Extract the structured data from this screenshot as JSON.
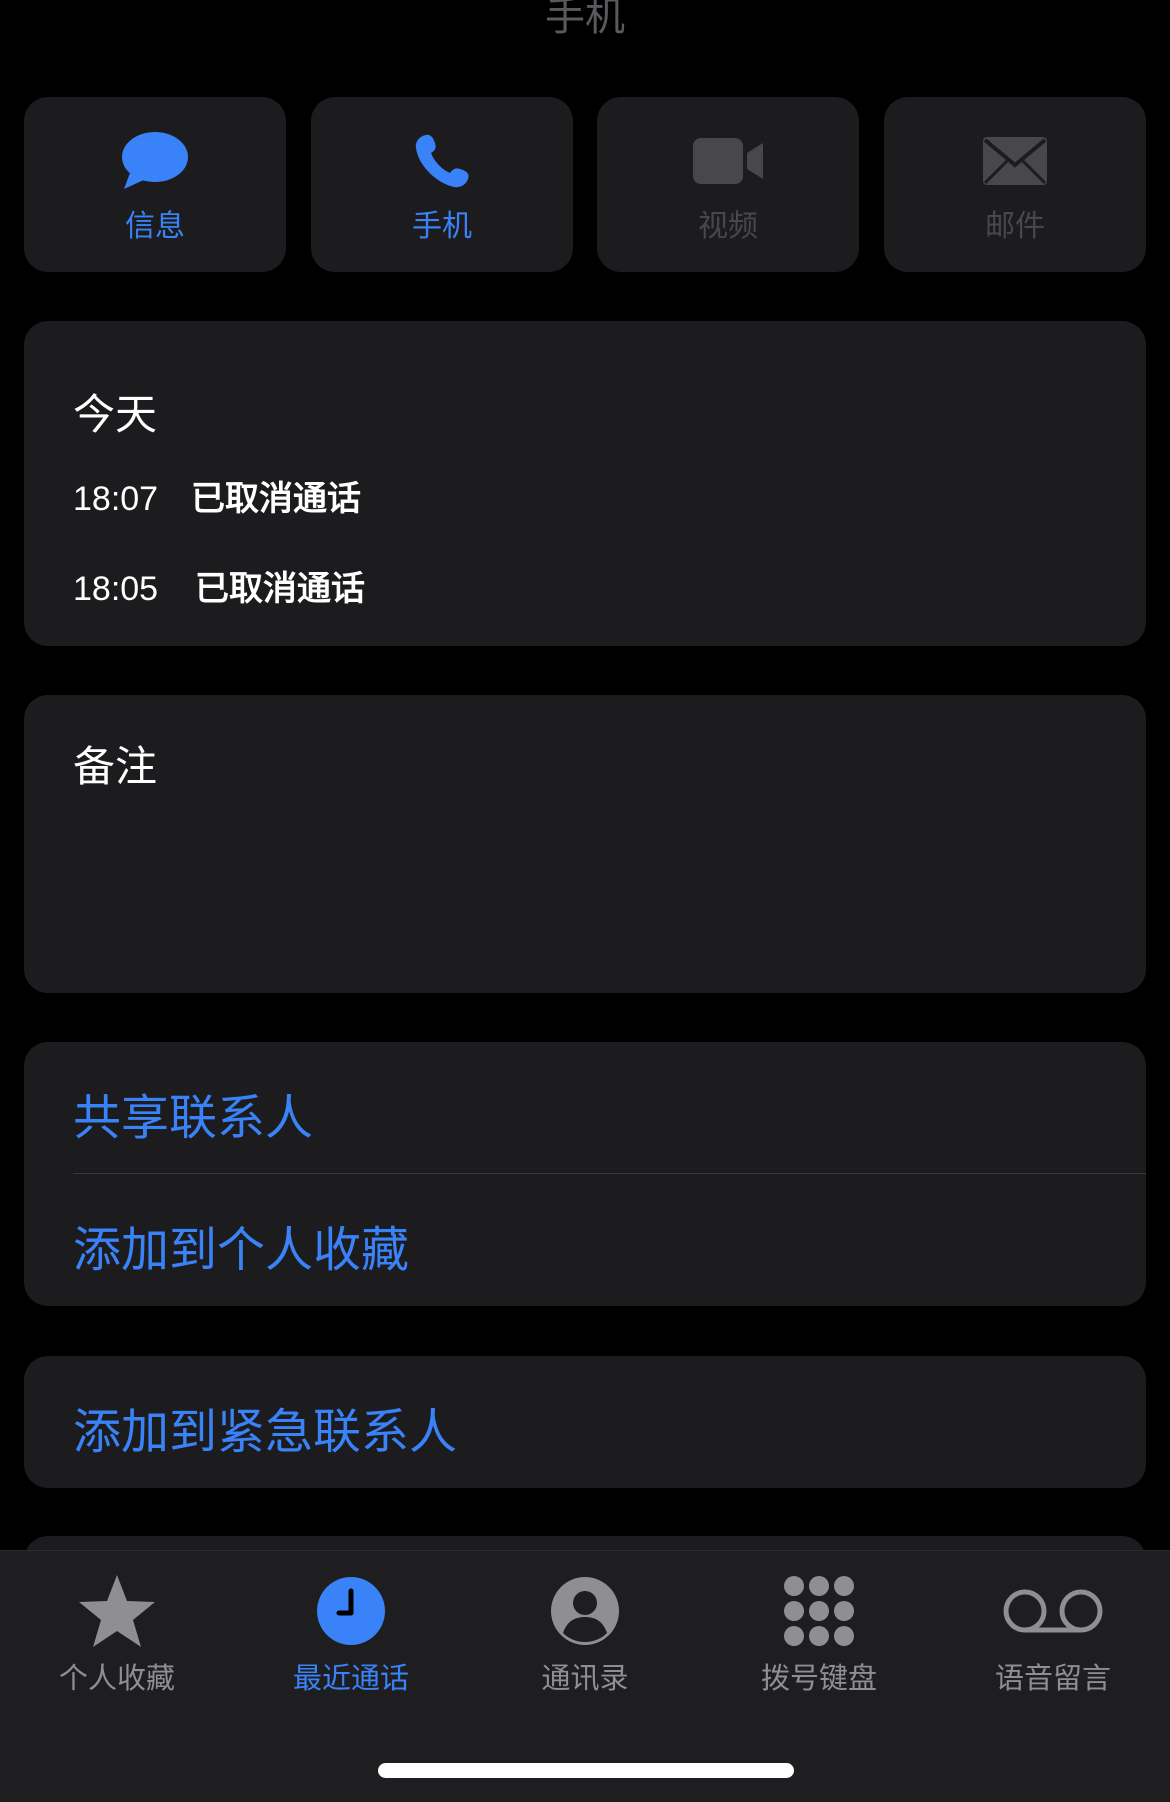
{
  "header": {
    "title": "手机"
  },
  "actions": [
    {
      "label": "信息",
      "icon": "message-bubble-icon",
      "enabled": true
    },
    {
      "label": "手机",
      "icon": "phone-icon",
      "enabled": true
    },
    {
      "label": "视频",
      "icon": "video-camera-icon",
      "enabled": false
    },
    {
      "label": "邮件",
      "icon": "envelope-icon",
      "enabled": false
    }
  ],
  "calls": {
    "date_label": "今天",
    "items": [
      {
        "time": "18:07",
        "status": "已取消通话"
      },
      {
        "time": "18:05",
        "status": "已取消通话"
      }
    ]
  },
  "notes": {
    "label": "备注"
  },
  "contact_actions": {
    "share": "共享联系人",
    "add_favorites": "添加到个人收藏",
    "add_emergency": "添加到紧急联系人"
  },
  "tabbar": {
    "items": [
      {
        "label": "个人收藏",
        "icon": "star-icon"
      },
      {
        "label": "最近通话",
        "icon": "clock-icon"
      },
      {
        "label": "通讯录",
        "icon": "person-circle-icon"
      },
      {
        "label": "拨号键盘",
        "icon": "keypad-icon"
      },
      {
        "label": "语音留言",
        "icon": "voicemail-icon"
      }
    ],
    "active_index": 1
  },
  "colors": {
    "accent": "#3a82f7",
    "background": "#000000",
    "card": "#1c1c1e",
    "disabled": "#48484a",
    "tab_inactive": "#8e8e93"
  }
}
